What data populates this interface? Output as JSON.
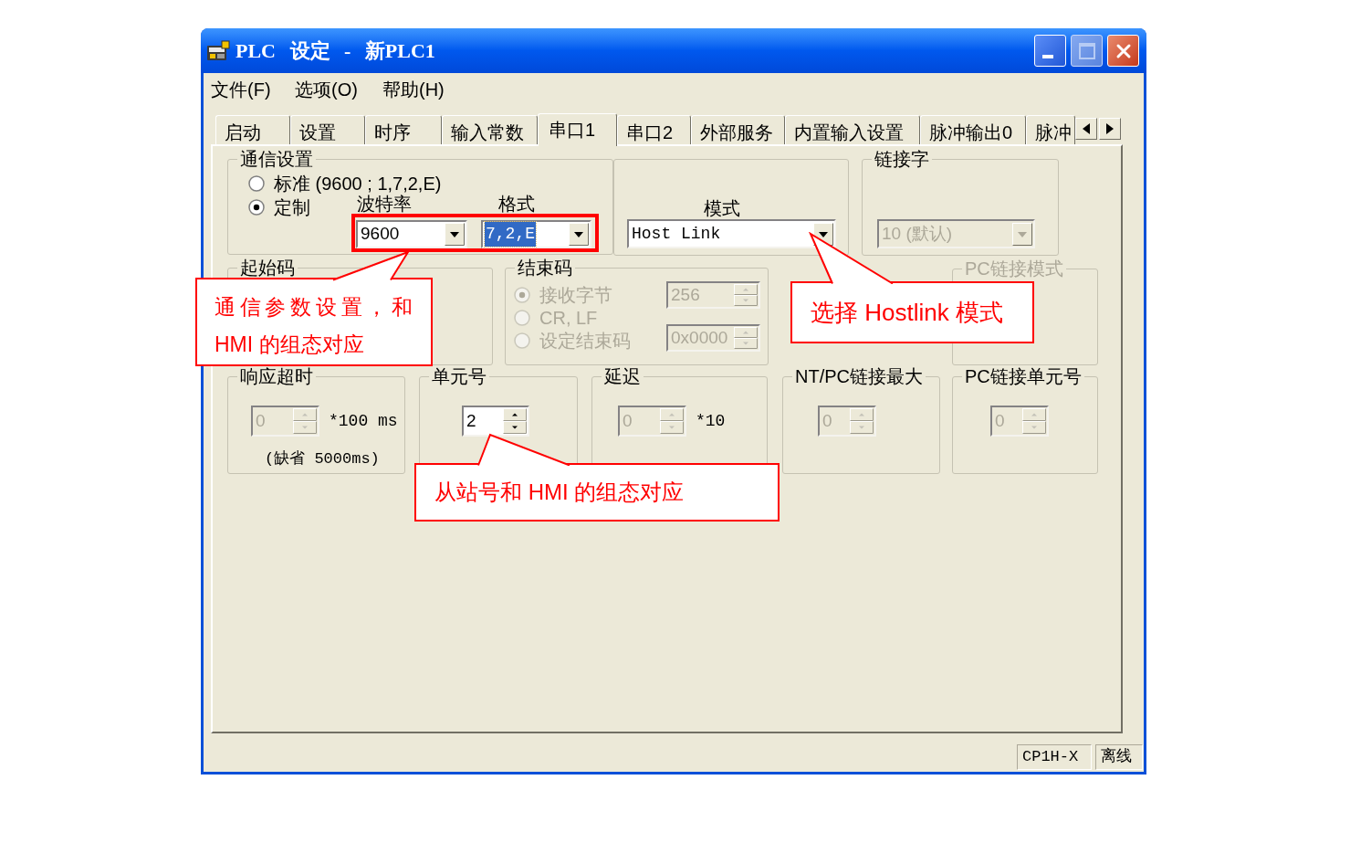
{
  "window": {
    "title": "PLC 设定 - 新PLC1"
  },
  "menu": [
    {
      "label": "文件(F)"
    },
    {
      "label": "选项(O)"
    },
    {
      "label": "帮助(H)"
    }
  ],
  "tabs": [
    {
      "label": "启动",
      "selected": false
    },
    {
      "label": "设置",
      "selected": false
    },
    {
      "label": "时序",
      "selected": false
    },
    {
      "label": "输入常数",
      "selected": false
    },
    {
      "label": "串口1",
      "selected": true
    },
    {
      "label": "串口2",
      "selected": false
    },
    {
      "label": "外部服务",
      "selected": false
    },
    {
      "label": "内置输入设置",
      "selected": false
    },
    {
      "label": "脉冲输出0",
      "selected": false
    },
    {
      "label": "脉冲",
      "selected": false
    }
  ],
  "communication_settings": {
    "title": "通信设置",
    "options": [
      {
        "label": "标准 (9600 ; 1,7,2,E)",
        "selected": false
      },
      {
        "label": "定制",
        "selected": true
      }
    ],
    "baud_rate": {
      "label": "波特率",
      "value": "9600"
    },
    "format": {
      "label": "格式",
      "value": "7,2,E",
      "focused": true
    }
  },
  "mode": {
    "label": "模式",
    "value": "Host Link"
  },
  "link_word": {
    "title": "链接字",
    "value": "10 (默认)",
    "disabled": true
  },
  "start_code": {
    "title": "起始码"
  },
  "end_code": {
    "title": "结束码",
    "disabled": true,
    "options": [
      {
        "label": "接收字节",
        "selected": true
      },
      {
        "label": "CR, LF",
        "selected": false
      },
      {
        "label": "设定结束码",
        "selected": false
      }
    ],
    "spinners": [
      {
        "value": "256"
      },
      {
        "value": "0x0000"
      }
    ]
  },
  "pc_link_mode": {
    "title": "PC链接模式",
    "disabled": true
  },
  "timing_groups": [
    {
      "title": "响应超时",
      "value": "0",
      "disabled": true,
      "unit": "*100 ms",
      "note": "(缺省 5000ms)"
    },
    {
      "title": "单元号",
      "value": "2",
      "disabled": false
    },
    {
      "title": "延迟",
      "value": "0",
      "disabled": true,
      "unit": "*10"
    },
    {
      "title": "NT/PC链接最大",
      "value": "0",
      "disabled": true
    },
    {
      "title": "PC链接单元号",
      "value": "0",
      "disabled": true
    }
  ],
  "status_bar": [
    {
      "text": "CP1H-X"
    },
    {
      "text": "离线"
    }
  ],
  "annotations": [
    {
      "text": "通信参数设置，和 HMI 的组态对应"
    },
    {
      "text": "选择 Hostlink 模式"
    },
    {
      "text": "从站号和 HMI 的组态对应"
    }
  ]
}
